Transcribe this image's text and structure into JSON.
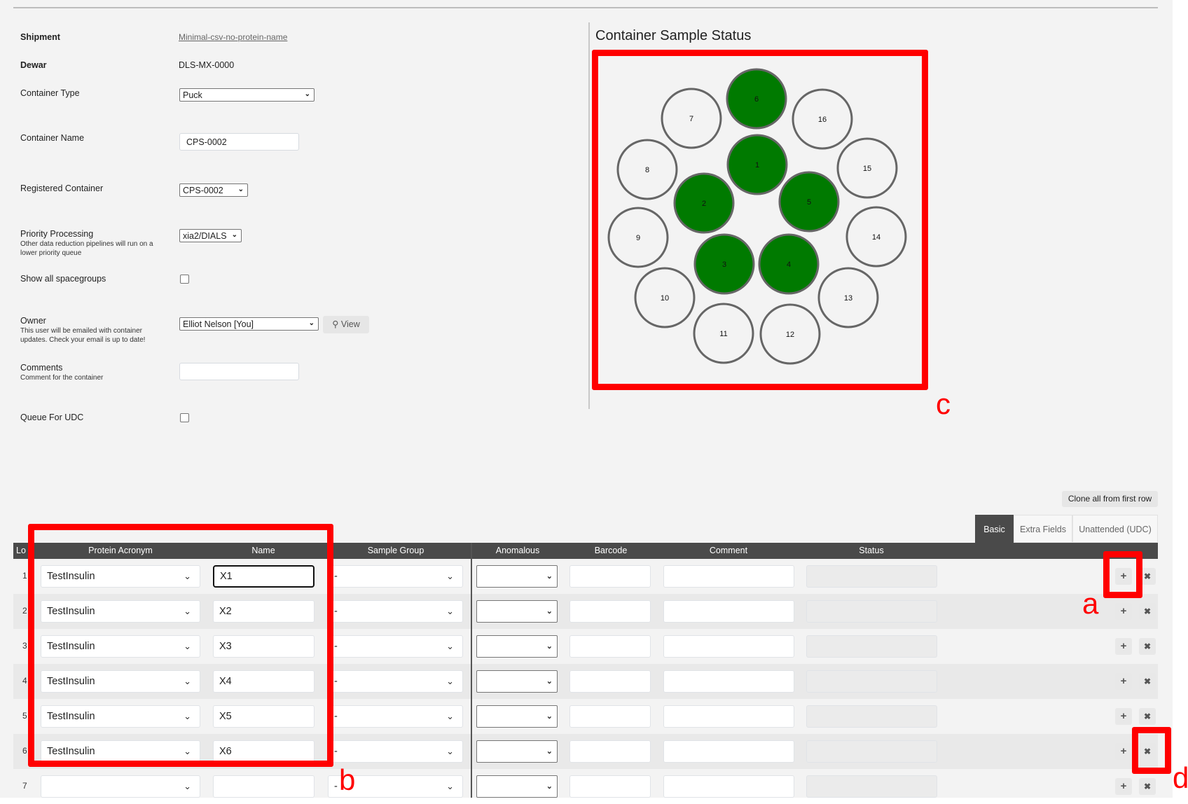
{
  "form": {
    "shipment_label": "Shipment",
    "shipment_value": "Minimal-csv-no-protein-name",
    "dewar_label": "Dewar",
    "dewar_value": "DLS-MX-0000",
    "container_type_label": "Container Type",
    "container_type_value": "Puck",
    "container_name_label": "Container Name",
    "container_name_value": "CPS-0002",
    "registered_container_label": "Registered Container",
    "registered_container_value": "CPS-0002",
    "priority_label": "Priority Processing",
    "priority_help": "Other data reduction pipelines will run on a lower priority queue",
    "priority_value": "xia2/DIALS",
    "spacegroups_label": "Show all spacegroups",
    "spacegroups_checked": false,
    "owner_label": "Owner",
    "owner_help": "This user will be emailed with container updates. Check your email is up to date!",
    "owner_value": "Elliot Nelson [You]",
    "view_label": "View",
    "comments_label": "Comments",
    "comments_help": "Comment for the container",
    "comments_value": "",
    "udc_label": "Queue For UDC",
    "udc_checked": false
  },
  "puck": {
    "title": "Container Sample Status",
    "filled_color": "#007a00",
    "empty_color": "#f3f3f3",
    "positions": [
      {
        "label": "1",
        "filled": true
      },
      {
        "label": "2",
        "filled": true
      },
      {
        "label": "3",
        "filled": true
      },
      {
        "label": "4",
        "filled": true
      },
      {
        "label": "5",
        "filled": true
      },
      {
        "label": "6",
        "filled": true
      },
      {
        "label": "7",
        "filled": false
      },
      {
        "label": "8",
        "filled": false
      },
      {
        "label": "9",
        "filled": false
      },
      {
        "label": "10",
        "filled": false
      },
      {
        "label": "11",
        "filled": false
      },
      {
        "label": "12",
        "filled": false
      },
      {
        "label": "13",
        "filled": false
      },
      {
        "label": "14",
        "filled": false
      },
      {
        "label": "15",
        "filled": false
      },
      {
        "label": "16",
        "filled": false
      }
    ]
  },
  "table": {
    "clone_label": "Clone all from first row",
    "tabs": [
      {
        "label": "Basic",
        "active": true
      },
      {
        "label": "Extra Fields",
        "active": false
      },
      {
        "label": "Unattended (UDC)",
        "active": false
      }
    ],
    "columns": [
      "Lo",
      "Protein Acronym",
      "Name",
      "Sample Group",
      "Anomalous",
      "Barcode",
      "Comment",
      "Status"
    ],
    "rows": [
      {
        "loc": "1",
        "protein": "TestInsulin",
        "name": "X1",
        "group": "-",
        "anomalous": "",
        "barcode": "",
        "comment": "",
        "status": ""
      },
      {
        "loc": "2",
        "protein": "TestInsulin",
        "name": "X2",
        "group": "-",
        "anomalous": "",
        "barcode": "",
        "comment": "",
        "status": ""
      },
      {
        "loc": "3",
        "protein": "TestInsulin",
        "name": "X3",
        "group": "-",
        "anomalous": "",
        "barcode": "",
        "comment": "",
        "status": ""
      },
      {
        "loc": "4",
        "protein": "TestInsulin",
        "name": "X4",
        "group": "-",
        "anomalous": "",
        "barcode": "",
        "comment": "",
        "status": ""
      },
      {
        "loc": "5",
        "protein": "TestInsulin",
        "name": "X5",
        "group": "-",
        "anomalous": "",
        "barcode": "",
        "comment": "",
        "status": ""
      },
      {
        "loc": "6",
        "protein": "TestInsulin",
        "name": "X6",
        "group": "-",
        "anomalous": "",
        "barcode": "",
        "comment": "",
        "status": ""
      },
      {
        "loc": "7",
        "protein": "",
        "name": "",
        "group": "-",
        "anomalous": "",
        "barcode": "",
        "comment": "",
        "status": ""
      }
    ],
    "add_icon": "plus-icon",
    "remove_icon": "close-icon"
  },
  "annotations": {
    "a": "a",
    "b": "b",
    "c": "c",
    "d": "d",
    "color": "#ff0000"
  }
}
